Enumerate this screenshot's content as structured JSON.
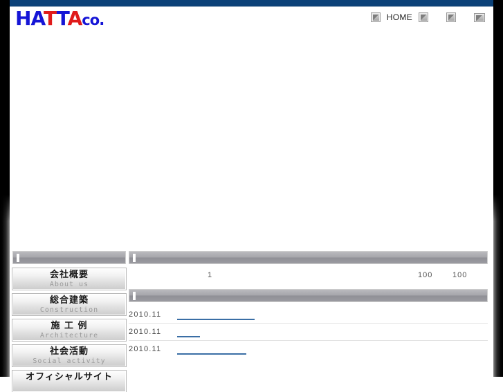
{
  "site": {
    "logo_text": "HATTAco.",
    "logo_color_primary": "#1515d6",
    "logo_color_accent": "#e01b1b",
    "topbar_color": "#0b4178"
  },
  "utility_nav": {
    "home_label": "HOME",
    "icons": [
      {
        "name": "broken-image-icon-home",
        "alt": ""
      },
      {
        "name": "broken-image-icon-1",
        "alt": ""
      },
      {
        "name": "broken-image-icon-2",
        "alt": ""
      },
      {
        "name": "broken-image-icon-mail",
        "alt": ""
      }
    ]
  },
  "sidebar": {
    "section_bar_label": "",
    "items": [
      {
        "ja": "会社概要",
        "en": "About us"
      },
      {
        "ja": "総合建築",
        "en": "Construction"
      },
      {
        "ja": "施 工 例",
        "en": "Architecture"
      },
      {
        "ja": "社会活動",
        "en": "Social activity"
      },
      {
        "ja": "オフィシャルサイト",
        "en": ""
      }
    ]
  },
  "main": {
    "info_section": {
      "bar_label": "",
      "cells": [
        "1",
        "100",
        "100"
      ]
    },
    "news_section": {
      "bar_label": "",
      "rows": [
        {
          "date": "2010.11",
          "link_text": ""
        },
        {
          "date": "2010.11",
          "link_text": ""
        },
        {
          "date": "2010.11",
          "link_text": ""
        }
      ]
    }
  }
}
